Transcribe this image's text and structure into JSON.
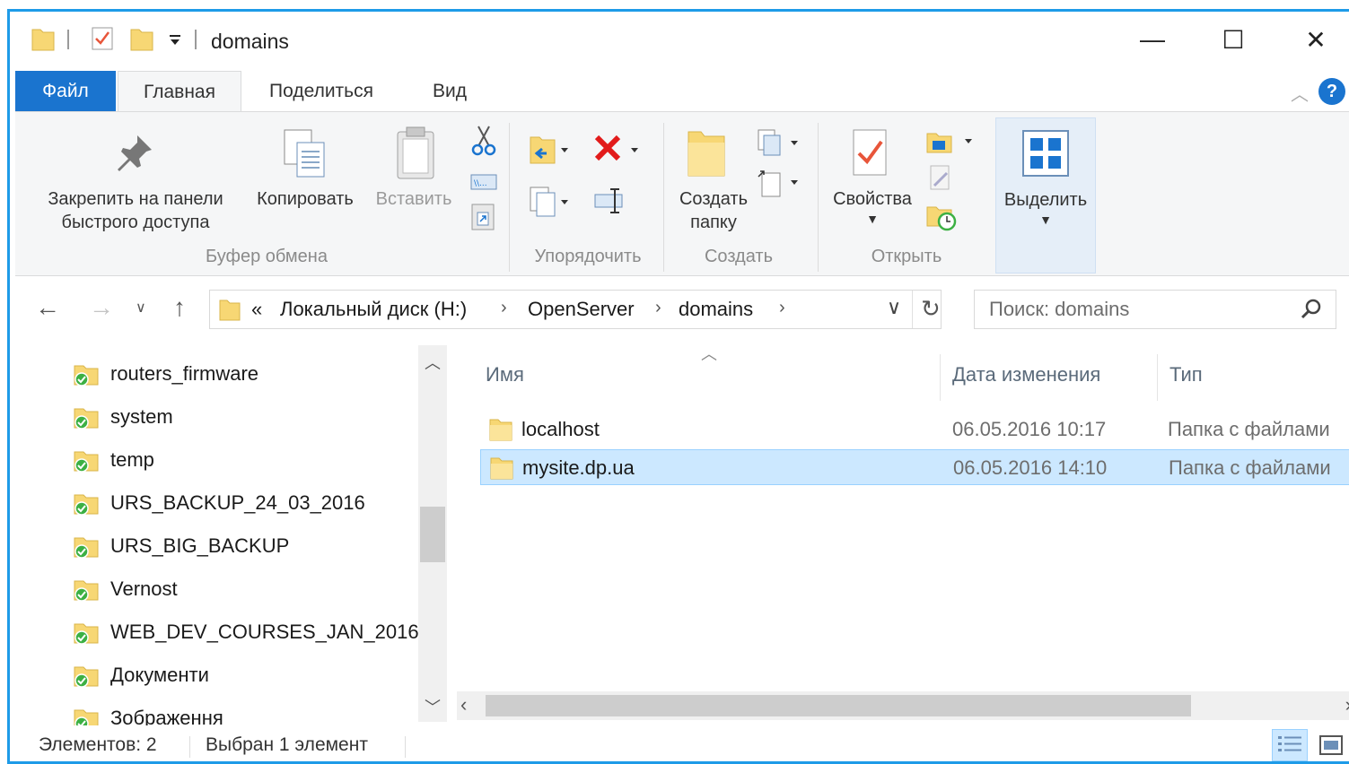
{
  "window": {
    "title": "domains",
    "controls": {
      "minimize": "—",
      "maximize": "☐",
      "close": "✕"
    }
  },
  "tabs": [
    "Файл",
    "Главная",
    "Поделиться",
    "Вид"
  ],
  "help_label": "?",
  "ribbon": {
    "clipboard": {
      "label": "Буфер обмена",
      "pin_line1": "Закрепить на панели",
      "pin_line2": "быстрого доступа",
      "copy": "Копировать",
      "paste": "Вставить"
    },
    "organize": {
      "label": "Упорядочить"
    },
    "create": {
      "label": "Создать",
      "new_folder_line1": "Создать",
      "new_folder_line2": "папку"
    },
    "open": {
      "label": "Открыть",
      "properties": "Свойства"
    },
    "select": {
      "label": "Выделить"
    }
  },
  "address": {
    "overflow": "«",
    "crumbs": [
      "Локальный диск (H:)",
      "OpenServer",
      "domains"
    ],
    "separator": "›",
    "search_placeholder": "Поиск: domains"
  },
  "nav_items": [
    "routers_firmware",
    "system",
    "temp",
    "URS_BACKUP_24_03_2016",
    "URS_BIG_BACKUP",
    "Vernost",
    "WEB_DEV_COURSES_JAN_2016",
    "Документи",
    "Зображення"
  ],
  "columns": {
    "name": "Имя",
    "date": "Дата изменения",
    "type": "Тип"
  },
  "files": [
    {
      "name": "localhost",
      "date": "06.05.2016 10:17",
      "type": "Папка с файлами",
      "selected": false
    },
    {
      "name": "mysite.dp.ua",
      "date": "06.05.2016 14:10",
      "type": "Папка с файлами",
      "selected": true
    }
  ],
  "status": {
    "count": "Элементов: 2",
    "selected": "Выбран 1 элемент"
  },
  "colors": {
    "accent": "#1e9be8",
    "file_tab": "#1a74cf",
    "selection": "#cce8ff",
    "folder": "#f7d774",
    "sync_green": "#3cb043"
  }
}
